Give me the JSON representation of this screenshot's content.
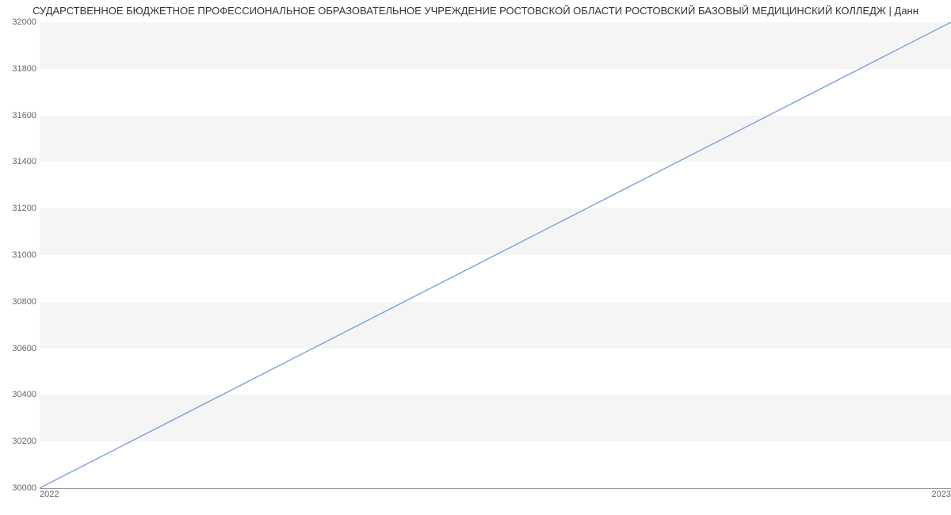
{
  "chart_data": {
    "type": "line",
    "title": "СУДАРСТВЕННОЕ БЮДЖЕТНОЕ ПРОФЕССИОНАЛЬНОЕ ОБРАЗОВАТЕЛЬНОЕ УЧРЕЖДЕНИЕ РОСТОВСКОЙ ОБЛАСТИ РОСТОВСКИЙ БАЗОВЫЙ МЕДИЦИНСКИЙ КОЛЛЕДЖ | Данн",
    "x": [
      2022,
      2023
    ],
    "values": [
      30000,
      32000
    ],
    "xlabel": "",
    "ylabel": "",
    "xlim": [
      2022,
      2023
    ],
    "ylim": [
      30000,
      32000
    ],
    "yticks": [
      30000,
      30200,
      30400,
      30600,
      30800,
      31000,
      31200,
      31400,
      31600,
      31800,
      32000
    ],
    "xticks": [
      2022,
      2023
    ],
    "line_color": "#7c9fd6"
  }
}
